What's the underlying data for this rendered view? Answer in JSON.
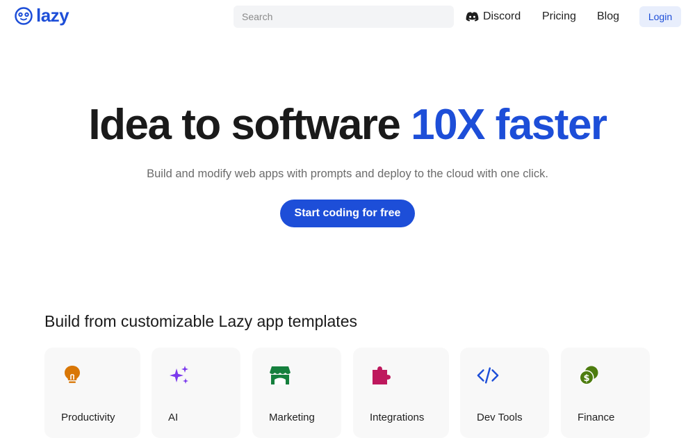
{
  "brand": {
    "name": "lazy",
    "logo_icon": "sloth-face-icon",
    "color": "#1d4ed8"
  },
  "nav": {
    "search_placeholder": "Search",
    "links": [
      {
        "label": "Discord",
        "icon": "discord-icon"
      },
      {
        "label": "Pricing"
      },
      {
        "label": "Blog"
      }
    ],
    "login_label": "Login"
  },
  "hero": {
    "title_main": "Idea to software ",
    "title_accent": "10X faster",
    "subtitle": "Build and modify web apps with prompts and deploy to the cloud with one click.",
    "cta_label": "Start coding for free"
  },
  "templates": {
    "title": "Build from customizable Lazy app templates",
    "cards": [
      {
        "label": "Productivity",
        "icon": "lightbulb-icon",
        "color": "#d97706"
      },
      {
        "label": "AI",
        "icon": "sparkles-icon",
        "color": "#7c3aed"
      },
      {
        "label": "Marketing",
        "icon": "storefront-icon",
        "color": "#15803d"
      },
      {
        "label": "Integrations",
        "icon": "puzzle-icon",
        "color": "#be185d"
      },
      {
        "label": "Dev Tools",
        "icon": "code-icon",
        "color": "#1d4ed8"
      },
      {
        "label": "Finance",
        "icon": "coins-icon",
        "color": "#4d7c0f"
      }
    ]
  }
}
